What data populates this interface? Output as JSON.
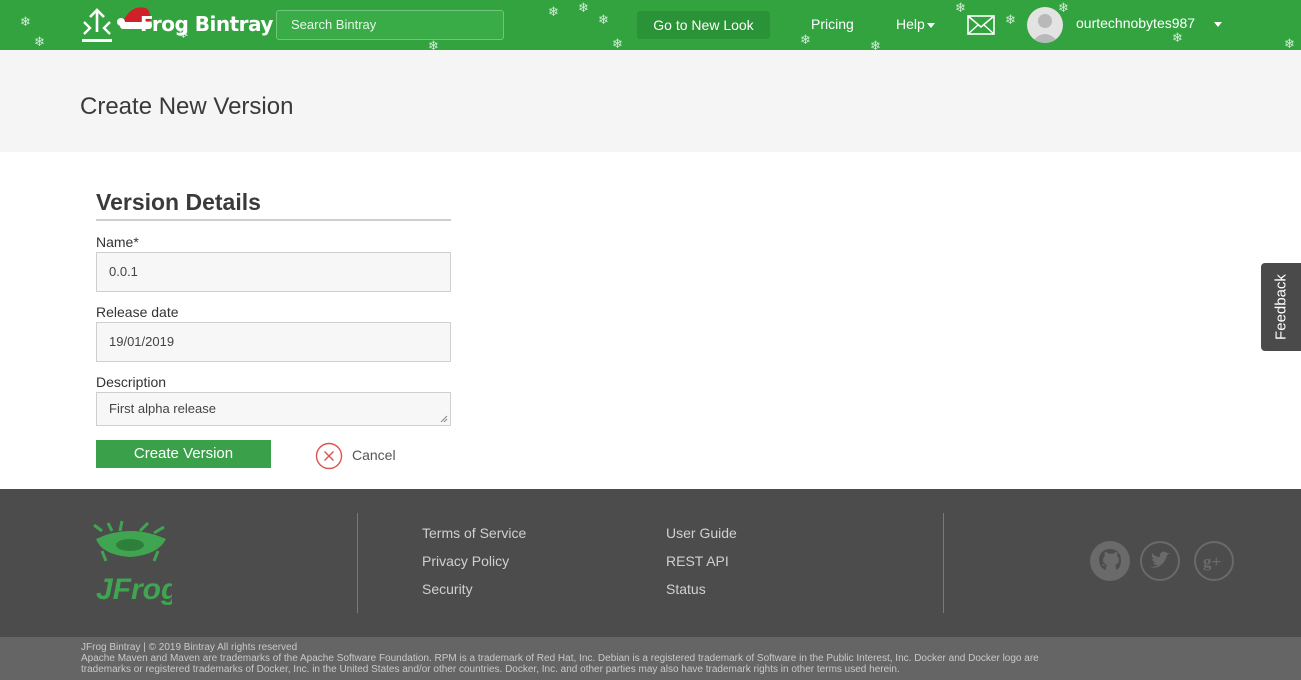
{
  "header": {
    "brand": "JFrog Bintray",
    "brand_text": "Frog Bintray",
    "search_placeholder": "Search Bintray",
    "new_look": "Go to New Look",
    "pricing": "Pricing",
    "help": "Help",
    "username": "ourtechnobytes987"
  },
  "page": {
    "title": "Create New Version"
  },
  "form": {
    "section_title": "Version Details",
    "name_label": "Name*",
    "name_value": "0.0.1",
    "release_label": "Release date",
    "release_value": "19/01/2019",
    "description_label": "Description",
    "description_value": "First alpha release",
    "create_label": "Create Version",
    "cancel_label": "Cancel"
  },
  "feedback": {
    "label": "Feedback"
  },
  "footer": {
    "links_col1": [
      "Terms of Service",
      "Privacy Policy",
      "Security"
    ],
    "links_col2": [
      "User Guide",
      "REST API",
      "Status"
    ],
    "social_icons": [
      "github-icon",
      "twitter-icon",
      "google-plus-icon"
    ],
    "legal_line1": "JFrog Bintray | © 2019 Bintray All rights reserved",
    "legal_line2": "Apache Maven and Maven are trademarks of the Apache Software Foundation. RPM is a trademark of Red Hat, Inc. Debian is a registered trademark of Software in the Public Interest, Inc. Docker and Docker logo are",
    "legal_line3": "trademarks or registered trademarks of Docker, Inc. in the United States and/or other countries. Docker, Inc. and other parties may also have trademark rights in other terms used herein."
  },
  "colors": {
    "header_green": "#33a340",
    "button_green": "#3aa14a",
    "footer_dark": "#4c4c4c",
    "cancel_red": "#d9534f"
  }
}
